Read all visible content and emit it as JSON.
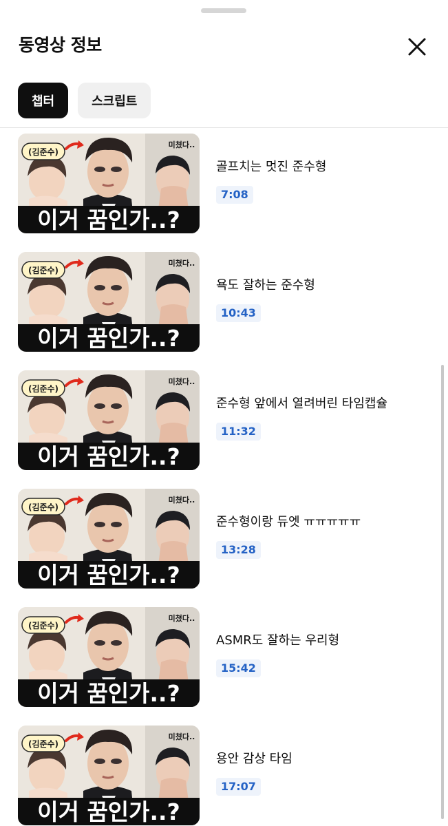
{
  "header": {
    "title": "동영상 정보",
    "tabs": [
      {
        "label": "챕터",
        "active": true
      },
      {
        "label": "스크립트",
        "active": false
      }
    ]
  },
  "thumbnail": {
    "caption": "이거 꿈인가..?",
    "tag": "(김준수)",
    "side_text": "미쳤다.."
  },
  "chapters": [
    {
      "title": "골프치는 멋진 준수형",
      "timestamp": "7:08"
    },
    {
      "title": "욕도 잘하는 준수형",
      "timestamp": "10:43"
    },
    {
      "title": "준수형 앞에서 열려버린 타임캡슐",
      "timestamp": "11:32"
    },
    {
      "title": "준수형이랑 듀엣 ㅠㅠㅠㅠㅠ",
      "timestamp": "13:28"
    },
    {
      "title": "ASMR도 잘하는 우리형",
      "timestamp": "15:42"
    },
    {
      "title": "용안 감상 타임",
      "timestamp": "17:07"
    }
  ],
  "colors": {
    "accent": "#2462c5",
    "chip_active": "#0f0f0f",
    "chip_inactive": "#f0f0f0"
  }
}
